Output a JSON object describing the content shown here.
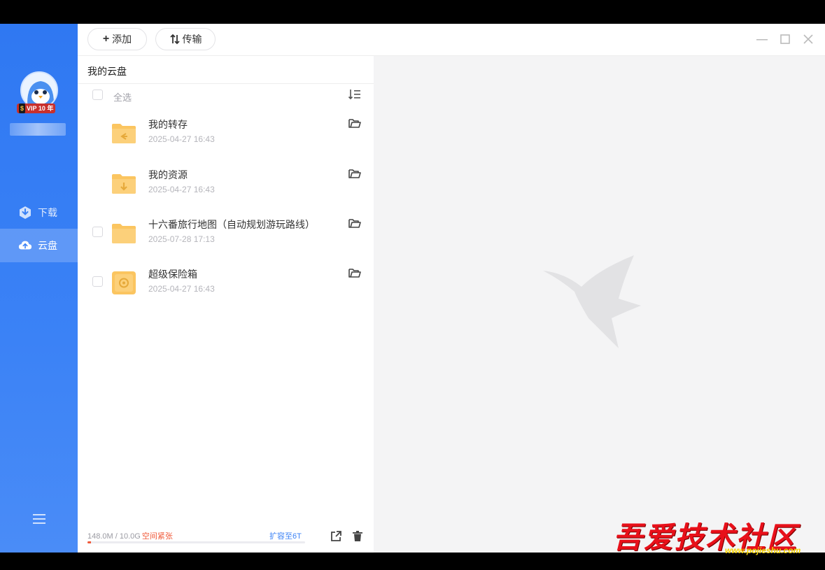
{
  "sidebar": {
    "vip_badge": "VIP 10 年",
    "vip_symbol": "$",
    "nav": [
      {
        "label": "下载",
        "icon": "download-icon"
      },
      {
        "label": "云盘",
        "icon": "cloud-icon",
        "active": true
      }
    ]
  },
  "toolbar": {
    "add_label": "添加",
    "transfer_label": "传输"
  },
  "panel": {
    "title": "我的云盘",
    "select_all": "全选",
    "files": [
      {
        "name": "我的转存",
        "date": "2025-04-27 16:43",
        "icon": "folder-transfer-icon",
        "checkbox": false
      },
      {
        "name": "我的资源",
        "date": "2025-04-27 16:43",
        "icon": "folder-download-icon",
        "checkbox": false
      },
      {
        "name": "十六番旅行地图（自动规划游玩路线）",
        "date": "2025-07-28 17:13",
        "icon": "folder-icon",
        "checkbox": true
      },
      {
        "name": "超级保险箱",
        "date": "2025-04-27 16:43",
        "icon": "safe-box-icon",
        "checkbox": true
      }
    ],
    "storage": {
      "used": "148.0M / 10.0G",
      "warning": "空间紧张",
      "expand": "扩容至6T",
      "fraction": 0.015
    }
  },
  "watermark": {
    "site_name": "吾爱技术社区",
    "site_url": "www.pojieshu.com"
  },
  "colors": {
    "accent": "#3b82f6",
    "folder": "#fbc560",
    "warning": "#f05a3a"
  }
}
